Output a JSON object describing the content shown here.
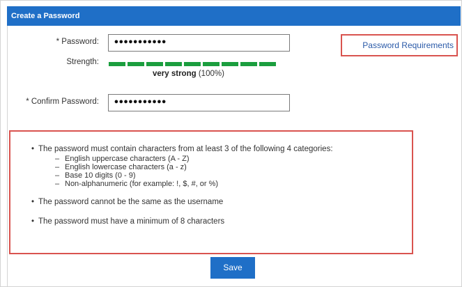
{
  "header": {
    "title": "Create a Password"
  },
  "form": {
    "password_label": "* Password:",
    "password_value": "•••••••••••",
    "strength_label": "Strength:",
    "strength_word": "very strong",
    "strength_percent_text": "(100%)",
    "strength_percent": 100,
    "strength_color": "#1b9e3e",
    "confirm_label": "* Confirm Password:",
    "confirm_value": "•••••••••••"
  },
  "requirements_link": {
    "label": "Password Requirements"
  },
  "rules": {
    "rule1": "The password must contain characters from at least 3 of the following 4 categories:",
    "categories": [
      "English uppercase characters (A - Z)",
      "English lowercase characters (a - z)",
      "Base 10 digits (0 - 9)",
      "Non-alphanumeric (for example: !, $, #, or %)"
    ],
    "rule2": "The password cannot be the same as the username",
    "rule3": "The password must have a minimum of 8 characters"
  },
  "actions": {
    "save_label": "Save"
  },
  "colors": {
    "accent": "#1f6fc7",
    "highlight": "#d9534f",
    "link": "#2a5aa8"
  }
}
